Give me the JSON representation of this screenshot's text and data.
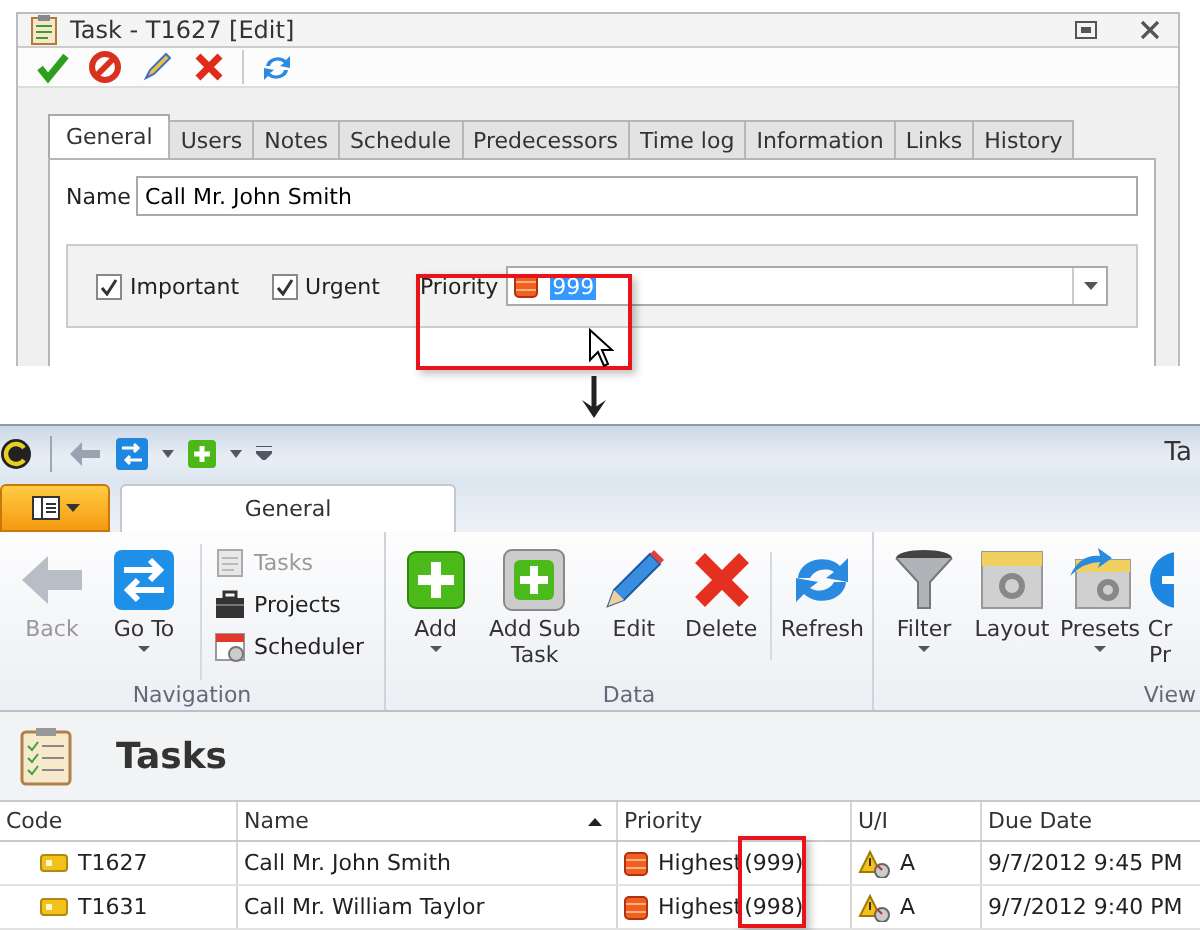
{
  "dialog": {
    "title": "Task - T1627 [Edit]",
    "tabs": [
      {
        "label": "General",
        "selected": true
      },
      {
        "label": "Users",
        "selected": false
      },
      {
        "label": "Notes",
        "selected": false
      },
      {
        "label": "Schedule",
        "selected": false
      },
      {
        "label": "Predecessors",
        "selected": false
      },
      {
        "label": "Time log",
        "selected": false
      },
      {
        "label": "Information",
        "selected": false
      },
      {
        "label": "Links",
        "selected": false
      },
      {
        "label": "History",
        "selected": false
      }
    ],
    "name": {
      "label": "Name",
      "value": "Call Mr. John Smith"
    },
    "checkboxes": [
      {
        "label": "Important",
        "checked": true
      },
      {
        "label": "Urgent",
        "checked": true
      }
    ],
    "priority": {
      "label": "Priority",
      "value": "999",
      "highlighted": true
    }
  },
  "app": {
    "title": "Ta",
    "ribbon_tabs": [
      {
        "label": "General",
        "selected": true
      }
    ],
    "groups": [
      {
        "label": "Navigation",
        "items": [
          {
            "kind": "large",
            "label": "Back",
            "disabled": true,
            "dropdown": false
          },
          {
            "kind": "large",
            "label": "Go To",
            "disabled": false,
            "dropdown": true
          },
          {
            "kind": "stack",
            "entries": [
              {
                "label": "Tasks",
                "disabled": true
              },
              {
                "label": "Projects",
                "disabled": false
              },
              {
                "label": "Scheduler",
                "disabled": false
              }
            ]
          }
        ]
      },
      {
        "label": "Data",
        "items": [
          {
            "kind": "large",
            "label": "Add",
            "disabled": false,
            "dropdown": true
          },
          {
            "kind": "large",
            "label": "Add Sub Task",
            "disabled": false,
            "dropdown": false
          },
          {
            "kind": "large",
            "label": "Edit",
            "disabled": false,
            "dropdown": false
          },
          {
            "kind": "large",
            "label": "Delete",
            "disabled": false,
            "dropdown": false
          },
          {
            "kind": "separator"
          },
          {
            "kind": "large",
            "label": "Refresh",
            "disabled": false,
            "dropdown": false
          }
        ]
      },
      {
        "label": "View",
        "items": [
          {
            "kind": "large",
            "label": "Filter",
            "disabled": false,
            "dropdown": true
          },
          {
            "kind": "large",
            "label": "Layout",
            "disabled": false,
            "dropdown": false
          },
          {
            "kind": "large",
            "label": "Presets",
            "disabled": false,
            "dropdown": true
          },
          {
            "kind": "large",
            "label": "Cr Pr",
            "disabled": false,
            "dropdown": false
          }
        ]
      }
    ],
    "list_title": "Tasks",
    "grid": {
      "columns": [
        {
          "label": "Code",
          "sorted": false
        },
        {
          "label": "Name",
          "sorted": true
        },
        {
          "label": "Priority",
          "sorted": false
        },
        {
          "label": "U/I",
          "sorted": false
        },
        {
          "label": "Due Date",
          "sorted": false
        }
      ],
      "rows": [
        {
          "code": "T1627",
          "name": "Call Mr. John Smith",
          "priority": "Highest",
          "priority_value": "(999)",
          "ui": "A",
          "due": "9/7/2012 9:45 PM"
        },
        {
          "code": "T1631",
          "name": "Call Mr. William Taylor",
          "priority": "Highest",
          "priority_value": "(998)",
          "ui": "A",
          "due": "9/7/2012 9:40 PM"
        }
      ],
      "highlight_priority_values": true
    }
  }
}
